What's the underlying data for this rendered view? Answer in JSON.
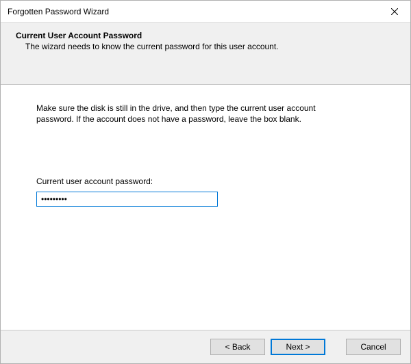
{
  "window": {
    "title": "Forgotten Password Wizard"
  },
  "header": {
    "title": "Current User Account Password",
    "subtitle": "The wizard needs to know the current password for this user account."
  },
  "body": {
    "instructions": "Make sure the disk is still in the drive, and then type the current user account password. If the account does not have a password, leave the box blank.",
    "password_label": "Current user account password:",
    "password_value": "•••••••••"
  },
  "footer": {
    "back_label": "< Back",
    "next_label": "Next >",
    "cancel_label": "Cancel"
  }
}
